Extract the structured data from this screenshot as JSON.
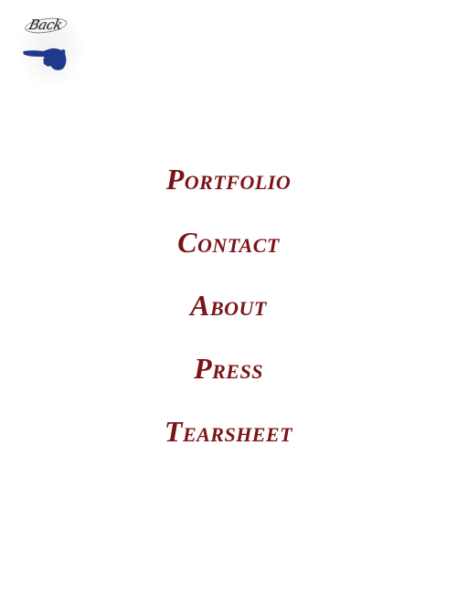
{
  "back": {
    "label": "Back",
    "icon": "pointing-hand-icon",
    "icon_color": "#1f3a8a"
  },
  "menu": {
    "color": "#7a1418",
    "items": [
      {
        "label": "Portfolio"
      },
      {
        "label": "Contact"
      },
      {
        "label": "About"
      },
      {
        "label": "Press"
      },
      {
        "label": "Tearsheet"
      }
    ]
  }
}
